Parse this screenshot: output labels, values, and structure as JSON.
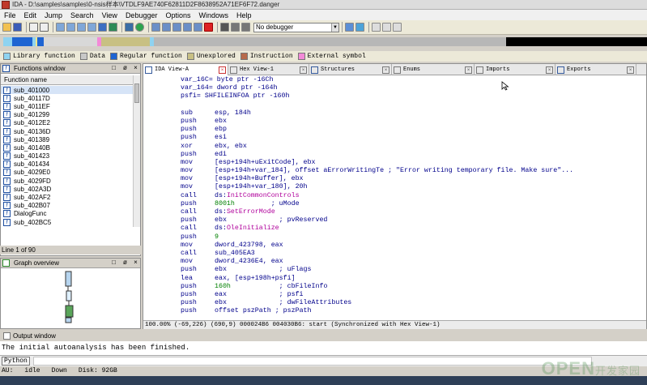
{
  "window": {
    "title": "IDA - D:\\samples\\samples\\0-nsis样本\\VTDLF9AE740F62811D2F8638952A71EF6F72.danger"
  },
  "menu": [
    "File",
    "Edit",
    "Jump",
    "Search",
    "View",
    "Debugger",
    "Options",
    "Windows",
    "Help"
  ],
  "toolbar": {
    "debugger_select": "No debugger"
  },
  "legend": [
    {
      "label": "Library function",
      "color": "#8fd3f1"
    },
    {
      "label": "Data",
      "color": "#c8c8c8"
    },
    {
      "label": "Regular function",
      "color": "#1e64d2"
    },
    {
      "label": "Unexplored",
      "color": "#c8c083"
    },
    {
      "label": "Instruction",
      "color": "#b76a4a"
    },
    {
      "label": "External symbol",
      "color": "#f38ad8"
    }
  ],
  "functions": {
    "title": "Functions window",
    "column": "Function name",
    "items": [
      "sub_401000",
      "sub_40117D",
      "sub_4011EF",
      "sub_401299",
      "sub_4012E2",
      "sub_40136D",
      "sub_401389",
      "sub_40140B",
      "sub_401423",
      "sub_401434",
      "sub_4029E0",
      "sub_4029FD",
      "sub_402A3D",
      "sub_402AF2",
      "sub_402B07",
      "DialogFunc",
      "sub_402BC5"
    ],
    "line_info": "Line 1 of 90"
  },
  "graph": {
    "title": "Graph overview"
  },
  "tabs": [
    {
      "label": "IDA View-A",
      "active": true
    },
    {
      "label": "Hex View-1"
    },
    {
      "label": "Structures"
    },
    {
      "label": "Enums"
    },
    {
      "label": "Imports"
    },
    {
      "label": "Exports"
    }
  ],
  "disasm": [
    {
      "text": "var_16C= byte ptr -16Ch"
    },
    {
      "text": "var_164= dword ptr -164h"
    },
    {
      "text": "psfi= SHFILEINFOA ptr -160h"
    },
    {
      "text": ""
    },
    {
      "mn": "sub",
      "ops": "esp, 184h"
    },
    {
      "mn": "push",
      "ops": "ebx"
    },
    {
      "mn": "push",
      "ops": "ebp"
    },
    {
      "mn": "push",
      "ops": "esi"
    },
    {
      "mn": "xor",
      "ops": "ebx, ebx"
    },
    {
      "mn": "push",
      "ops": "edi"
    },
    {
      "mn": "mov",
      "ops": "[esp+194h+uExitCode], ebx"
    },
    {
      "mn": "mov",
      "ops": "[esp+194h+var_184], offset aErrorWritingTe",
      "cm": " ; \"Error writing temporary file. Make sure\"..."
    },
    {
      "mn": "mov",
      "ops": "[esp+194h+Buffer], ebx"
    },
    {
      "mn": "mov",
      "ops": "[esp+194h+var_180], 20h"
    },
    {
      "mn": "call",
      "ops": "ds:",
      "api": "InitCommonControls"
    },
    {
      "mn": "push",
      "ops": "8001h",
      "cm": "         ; uMode",
      "num": true
    },
    {
      "mn": "call",
      "ops": "ds:",
      "api": "SetErrorMode"
    },
    {
      "mn": "push",
      "ops": "ebx",
      "cm": "             ; pvReserved"
    },
    {
      "mn": "call",
      "ops": "ds:",
      "api": "OleInitialize"
    },
    {
      "mn": "push",
      "ops": "9",
      "num": true
    },
    {
      "mn": "mov",
      "ops": "dword_423798, eax"
    },
    {
      "mn": "call",
      "ops": "sub_405EA3"
    },
    {
      "mn": "mov",
      "ops": "dword_4236E4, eax"
    },
    {
      "mn": "push",
      "ops": "ebx",
      "cm": "             ; uFlags"
    },
    {
      "mn": "lea",
      "ops": "eax, [esp+198h+psfi]"
    },
    {
      "mn": "push",
      "ops": "160h",
      "cm": "            ; cbFileInfo",
      "num": true
    },
    {
      "mn": "push",
      "ops": "eax",
      "cm": "             ; psfi"
    },
    {
      "mn": "push",
      "ops": "ebx",
      "cm": "             ; dwFileAttributes"
    },
    {
      "mn": "push",
      "ops": "offset pszPath",
      "cm": " ; pszPath"
    }
  ],
  "status_line": "100.00% (-69,226) (690,9) 000024B6 004030B6: start (Synchronized with Hex View-1)",
  "output": {
    "title": "Output window",
    "text": "The initial autoanalysis has been finished.",
    "python_label": "Python"
  },
  "statusbar": {
    "au": "AU:",
    "au_state": "idle",
    "down": "Down",
    "disk": "Disk: 92GB"
  },
  "watermark": {
    "brand": "OPEN",
    "tagline": "开发家园"
  }
}
